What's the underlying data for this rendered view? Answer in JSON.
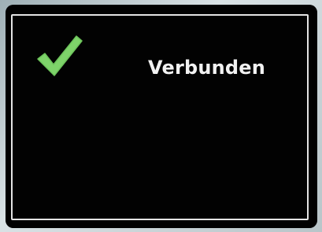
{
  "status": {
    "label": "Verbunden",
    "icon": "checkmark-icon",
    "icon_color": "#7ed36a"
  },
  "colors": {
    "screen_background": "#020202",
    "frame_border": "#e4e4e4",
    "text": "#f2f2f2"
  }
}
